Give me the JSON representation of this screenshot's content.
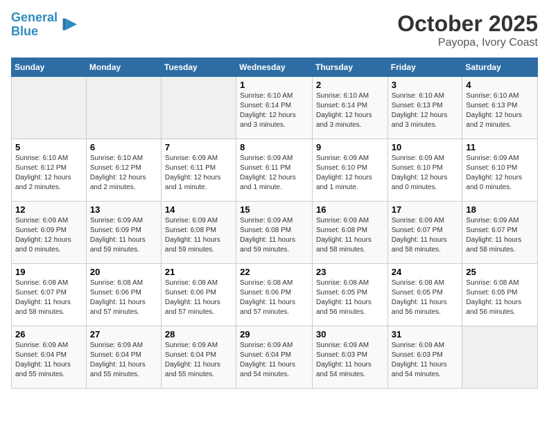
{
  "header": {
    "logo_line1": "General",
    "logo_line2": "Blue",
    "title": "October 2025",
    "subtitle": "Payopa, Ivory Coast"
  },
  "days_of_week": [
    "Sunday",
    "Monday",
    "Tuesday",
    "Wednesday",
    "Thursday",
    "Friday",
    "Saturday"
  ],
  "weeks": [
    [
      {
        "day": "",
        "info": ""
      },
      {
        "day": "",
        "info": ""
      },
      {
        "day": "",
        "info": ""
      },
      {
        "day": "1",
        "info": "Sunrise: 6:10 AM\nSunset: 6:14 PM\nDaylight: 12 hours and 3 minutes."
      },
      {
        "day": "2",
        "info": "Sunrise: 6:10 AM\nSunset: 6:14 PM\nDaylight: 12 hours and 3 minutes."
      },
      {
        "day": "3",
        "info": "Sunrise: 6:10 AM\nSunset: 6:13 PM\nDaylight: 12 hours and 3 minutes."
      },
      {
        "day": "4",
        "info": "Sunrise: 6:10 AM\nSunset: 6:13 PM\nDaylight: 12 hours and 2 minutes."
      }
    ],
    [
      {
        "day": "5",
        "info": "Sunrise: 6:10 AM\nSunset: 6:12 PM\nDaylight: 12 hours and 2 minutes."
      },
      {
        "day": "6",
        "info": "Sunrise: 6:10 AM\nSunset: 6:12 PM\nDaylight: 12 hours and 2 minutes."
      },
      {
        "day": "7",
        "info": "Sunrise: 6:09 AM\nSunset: 6:11 PM\nDaylight: 12 hours and 1 minute."
      },
      {
        "day": "8",
        "info": "Sunrise: 6:09 AM\nSunset: 6:11 PM\nDaylight: 12 hours and 1 minute."
      },
      {
        "day": "9",
        "info": "Sunrise: 6:09 AM\nSunset: 6:10 PM\nDaylight: 12 hours and 1 minute."
      },
      {
        "day": "10",
        "info": "Sunrise: 6:09 AM\nSunset: 6:10 PM\nDaylight: 12 hours and 0 minutes."
      },
      {
        "day": "11",
        "info": "Sunrise: 6:09 AM\nSunset: 6:10 PM\nDaylight: 12 hours and 0 minutes."
      }
    ],
    [
      {
        "day": "12",
        "info": "Sunrise: 6:09 AM\nSunset: 6:09 PM\nDaylight: 12 hours and 0 minutes."
      },
      {
        "day": "13",
        "info": "Sunrise: 6:09 AM\nSunset: 6:09 PM\nDaylight: 11 hours and 59 minutes."
      },
      {
        "day": "14",
        "info": "Sunrise: 6:09 AM\nSunset: 6:08 PM\nDaylight: 11 hours and 59 minutes."
      },
      {
        "day": "15",
        "info": "Sunrise: 6:09 AM\nSunset: 6:08 PM\nDaylight: 11 hours and 59 minutes."
      },
      {
        "day": "16",
        "info": "Sunrise: 6:09 AM\nSunset: 6:08 PM\nDaylight: 11 hours and 58 minutes."
      },
      {
        "day": "17",
        "info": "Sunrise: 6:09 AM\nSunset: 6:07 PM\nDaylight: 11 hours and 58 minutes."
      },
      {
        "day": "18",
        "info": "Sunrise: 6:09 AM\nSunset: 6:07 PM\nDaylight: 11 hours and 58 minutes."
      }
    ],
    [
      {
        "day": "19",
        "info": "Sunrise: 6:08 AM\nSunset: 6:07 PM\nDaylight: 11 hours and 58 minutes."
      },
      {
        "day": "20",
        "info": "Sunrise: 6:08 AM\nSunset: 6:06 PM\nDaylight: 11 hours and 57 minutes."
      },
      {
        "day": "21",
        "info": "Sunrise: 6:08 AM\nSunset: 6:06 PM\nDaylight: 11 hours and 57 minutes."
      },
      {
        "day": "22",
        "info": "Sunrise: 6:08 AM\nSunset: 6:06 PM\nDaylight: 11 hours and 57 minutes."
      },
      {
        "day": "23",
        "info": "Sunrise: 6:08 AM\nSunset: 6:05 PM\nDaylight: 11 hours and 56 minutes."
      },
      {
        "day": "24",
        "info": "Sunrise: 6:08 AM\nSunset: 6:05 PM\nDaylight: 11 hours and 56 minutes."
      },
      {
        "day": "25",
        "info": "Sunrise: 6:08 AM\nSunset: 6:05 PM\nDaylight: 11 hours and 56 minutes."
      }
    ],
    [
      {
        "day": "26",
        "info": "Sunrise: 6:09 AM\nSunset: 6:04 PM\nDaylight: 11 hours and 55 minutes."
      },
      {
        "day": "27",
        "info": "Sunrise: 6:09 AM\nSunset: 6:04 PM\nDaylight: 11 hours and 55 minutes."
      },
      {
        "day": "28",
        "info": "Sunrise: 6:09 AM\nSunset: 6:04 PM\nDaylight: 11 hours and 55 minutes."
      },
      {
        "day": "29",
        "info": "Sunrise: 6:09 AM\nSunset: 6:04 PM\nDaylight: 11 hours and 54 minutes."
      },
      {
        "day": "30",
        "info": "Sunrise: 6:09 AM\nSunset: 6:03 PM\nDaylight: 11 hours and 54 minutes."
      },
      {
        "day": "31",
        "info": "Sunrise: 6:09 AM\nSunset: 6:03 PM\nDaylight: 11 hours and 54 minutes."
      },
      {
        "day": "",
        "info": ""
      }
    ]
  ]
}
